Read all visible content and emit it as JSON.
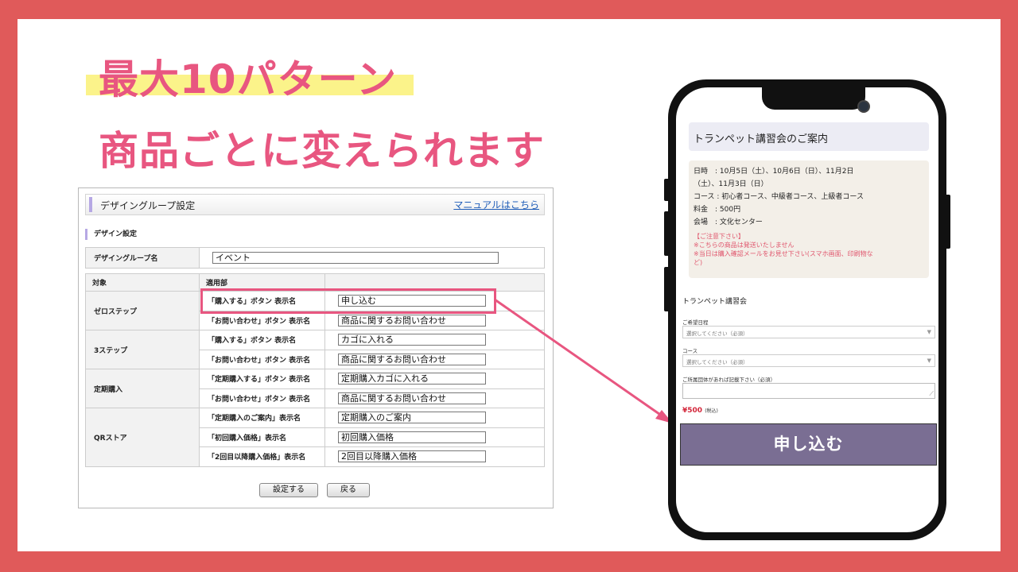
{
  "headline": {
    "line1": "最大10パターン",
    "line2": "商品ごとに変えられます"
  },
  "panel": {
    "title": "デザイングループ設定",
    "manual_link": "マニュアルはこちら",
    "section": "デザイン設定",
    "group_name_label": "デザイングループ名",
    "group_name_value": "イベント",
    "col_target": "対象",
    "col_applied": "適用部",
    "rows": [
      {
        "group": "ゼロステップ",
        "label": "「購入する」ボタン 表示名",
        "value": "申し込む"
      },
      {
        "group": "",
        "label": "「お問い合わせ」ボタン 表示名",
        "value": "商品に関するお問い合わせ"
      },
      {
        "group": "3ステップ",
        "label": "「購入する」ボタン 表示名",
        "value": "カゴに入れる"
      },
      {
        "group": "",
        "label": "「お問い合わせ」ボタン 表示名",
        "value": "商品に関するお問い合わせ"
      },
      {
        "group": "定期購入",
        "label": "「定期購入する」ボタン 表示名",
        "value": "定期購入カゴに入れる"
      },
      {
        "group": "",
        "label": "「お問い合わせ」ボタン 表示名",
        "value": "商品に関するお問い合わせ"
      },
      {
        "group": "QRストア",
        "label": "「定期購入のご案内」表示名",
        "value": "定期購入のご案内"
      },
      {
        "group": "",
        "label": "「初回購入価格」表示名",
        "value": "初回購入価格"
      },
      {
        "group": "",
        "label": "「2回目以降購入価格」表示名",
        "value": "2回目以降購入価格"
      }
    ],
    "save_button": "設定する",
    "back_button": "戻る"
  },
  "phone": {
    "event_title": "トランペット講習会のご案内",
    "info_lines": [
      "日時　: 10月5日（土）、10月6日（日）、11月2日",
      "（土）、11月3日（日）",
      "コース : 初心者コース、中級者コース、上級者コース",
      "料金　: 500円",
      "会場　: 文化センター"
    ],
    "notice_lines": [
      "【ご注意下さい】",
      "※こちらの商品は発送いたしません",
      "※当日は購入確認メールをお見せ下さい(スマホ画面、印刷物な",
      "ど)"
    ],
    "form_title": "トランペット講習会",
    "date_label": "ご希望日程",
    "date_placeholder": "選択してください（必須）",
    "course_label": "コース",
    "course_placeholder": "選択してください（必須）",
    "org_label": "ご所属団体があれば記載下さい（必須）",
    "price": "¥500",
    "price_note": "(税込)",
    "apply_button": "申し込む"
  },
  "colors": {
    "frame": "#e05a5a",
    "headline": "#e85680",
    "highlight": "#fbf38a",
    "callout": "#e85680",
    "apply_button": "#7a6e93"
  }
}
